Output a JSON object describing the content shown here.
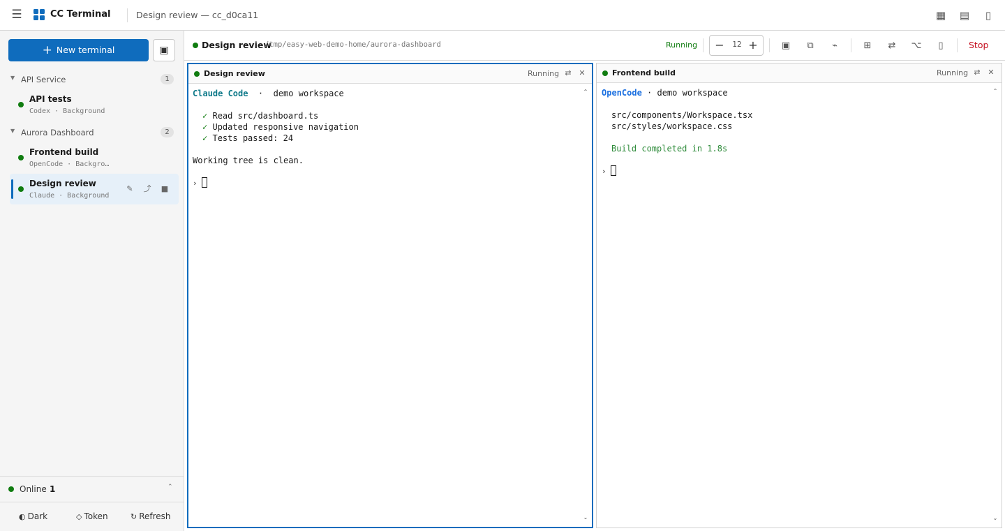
{
  "app": {
    "title": "CC Terminal",
    "window_title": "Design review — cc_d0ca11",
    "menu_icon": "☰",
    "top_icons": [
      "▦",
      "▤",
      "▯"
    ]
  },
  "sidebar": {
    "new_terminal_label": "New terminal",
    "toggle_icon": "▣",
    "groups": [
      {
        "name": "API Service",
        "count": "1",
        "items": [
          {
            "name": "API tests",
            "meta": "Codex · Background"
          }
        ]
      },
      {
        "name": "Aurora Dashboard",
        "count": "2",
        "items": [
          {
            "name": "Frontend build",
            "meta": "OpenCode · Backgro…"
          },
          {
            "name": "Design review",
            "meta": "Claude · Background"
          }
        ]
      }
    ],
    "active_item_actions": [
      "✎",
      "⤴",
      "■"
    ],
    "status": {
      "label": "Online",
      "count": "1",
      "chevron": "⌃"
    },
    "footer": {
      "dark": {
        "icon": "◐",
        "label": "Dark"
      },
      "token": {
        "icon": "◇",
        "label": "Token"
      },
      "refresh": {
        "icon": "↻",
        "label": "Refresh"
      }
    }
  },
  "session": {
    "name": "Design review",
    "path": "/tmp/easy-web-demo-home/aurora-dashboard",
    "status": "Running",
    "font_size": "12",
    "minus": "−",
    "plus": "+",
    "tool_icons": [
      "▣",
      "⧉",
      "⌁",
      "⊞",
      "⇄",
      "⌥",
      "▯"
    ],
    "stop_label": "Stop"
  },
  "panes": [
    {
      "title": "Design review",
      "status": "Running",
      "swap_icon": "⇄",
      "close_icon": "✕",
      "header": {
        "brand": "Claude Code",
        "sep": "  ·  ",
        "rest": "demo workspace"
      },
      "checks": [
        "Read src/dashboard.ts",
        "Updated responsive navigation",
        "Tests passed: 24"
      ],
      "check_mark": "✓",
      "message": "Working tree is clean.",
      "prompt": "›"
    },
    {
      "title": "Frontend build",
      "status": "Running",
      "swap_icon": "⇄",
      "close_icon": "✕",
      "header": {
        "brand": "OpenCode",
        "sep": " · ",
        "rest": "demo workspace"
      },
      "files": [
        "src/components/Workspace.tsx",
        "src/styles/workspace.css"
      ],
      "message": "Build completed in 1.8s",
      "prompt": "›"
    }
  ],
  "scroll": {
    "up": "⌃",
    "down": "⌄"
  },
  "colors": {
    "accent": "#0f6cbd",
    "running": "#107c10",
    "stop": "#c50f1f",
    "claude_brand": "#0f7a8a",
    "opencode_brand": "#1a6fe0"
  }
}
